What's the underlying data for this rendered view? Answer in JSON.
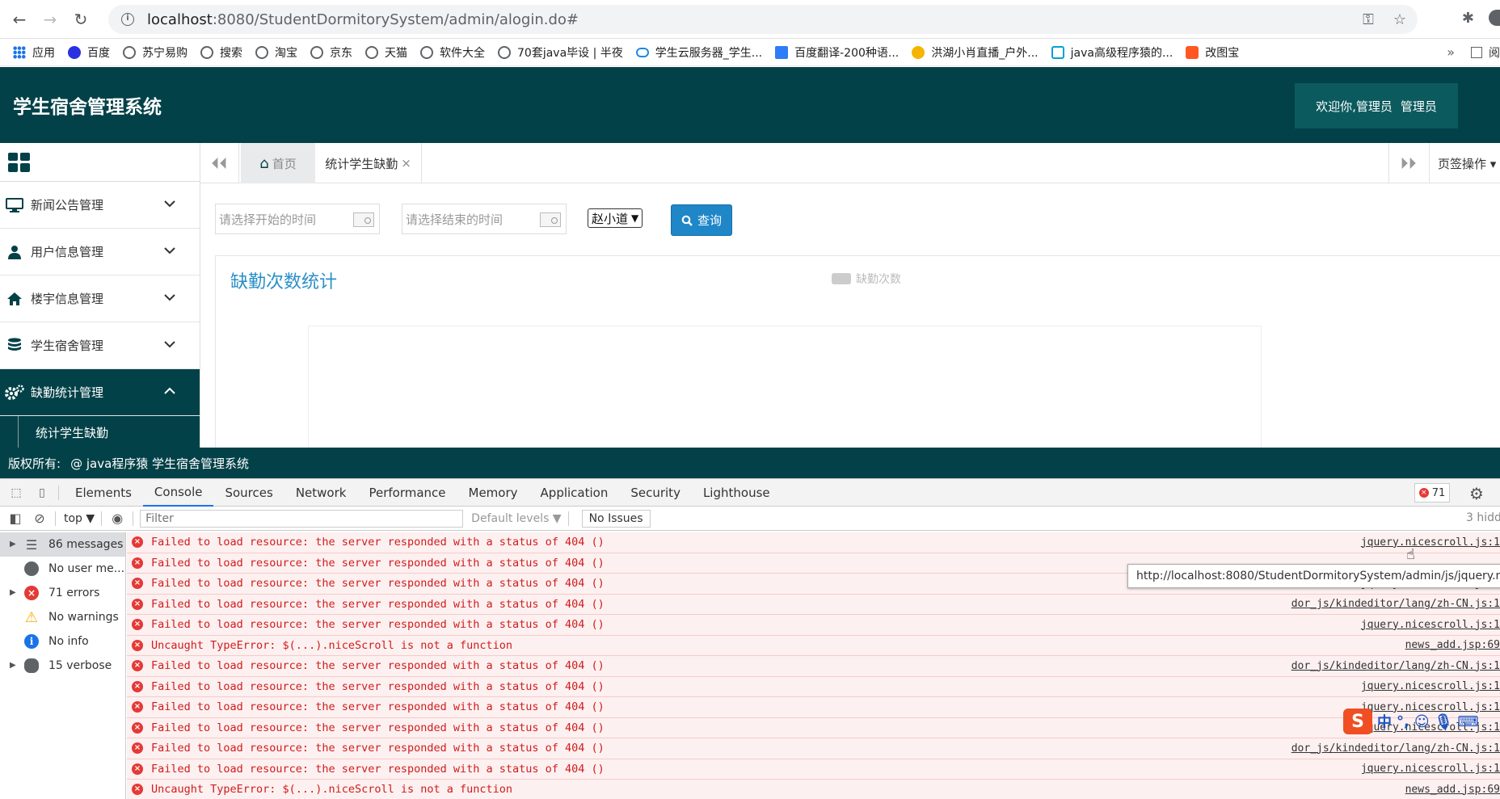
{
  "browser": {
    "url_host": "localhost",
    "url_rest": ":8080/StudentDormitorySystem/admin/alogin.do#",
    "bookmarks": [
      {
        "label": "应用",
        "icon": "apps-icon"
      },
      {
        "label": "百度",
        "icon": "baidu-icon"
      },
      {
        "label": "苏宁易购",
        "icon": "globe-icon"
      },
      {
        "label": "搜索",
        "icon": "globe-icon"
      },
      {
        "label": "淘宝",
        "icon": "globe-icon"
      },
      {
        "label": "京东",
        "icon": "globe-icon"
      },
      {
        "label": "天猫",
        "icon": "globe-icon"
      },
      {
        "label": "软件大全",
        "icon": "globe-icon"
      },
      {
        "label": "70套java毕设 | 半夜",
        "icon": "globe-icon"
      },
      {
        "label": "学生云服务器_学生...",
        "icon": "cloud-icon"
      },
      {
        "label": "百度翻译-200种语...",
        "icon": "fanyi-icon"
      },
      {
        "label": "洪湖小肖直播_户外...",
        "icon": "huya-icon"
      },
      {
        "label": "java高级程序猿的...",
        "icon": "bilibili-icon"
      },
      {
        "label": "改图宝",
        "icon": "gaitubao-icon"
      }
    ],
    "bookmarks_more": "»",
    "reading_list": "阅"
  },
  "app": {
    "title": "学生宿舍管理系统",
    "welcome": "欢迎你,管理员",
    "role": "管理员",
    "footer_label": "版权所有:",
    "footer_text": "@ java程序猿 学生宿舍管理系统"
  },
  "sidebar": {
    "items": [
      {
        "label": "新闻公告管理",
        "icon": "monitor-icon"
      },
      {
        "label": "用户信息管理",
        "icon": "user-icon"
      },
      {
        "label": "楼宇信息管理",
        "icon": "home-icon"
      },
      {
        "label": "学生宿舍管理",
        "icon": "database-icon"
      },
      {
        "label": "缺勤统计管理",
        "icon": "gears-icon"
      }
    ],
    "sub_items": [
      "统计学生缺勤"
    ]
  },
  "tabs": {
    "home": "首页",
    "current": "统计学生缺勤",
    "close": "×",
    "ops": "页签操作 ▾"
  },
  "filters": {
    "start_placeholder": "请选择开始的时间",
    "end_placeholder": "请选择结束的时间",
    "student_selected": "赵小道",
    "query_label": "查询"
  },
  "chart_data": {
    "type": "bar",
    "title": "缺勤次数统计",
    "legend": [
      "缺勤次数"
    ],
    "categories": [],
    "values": []
  },
  "devtools": {
    "tabs": [
      "Elements",
      "Console",
      "Sources",
      "Network",
      "Performance",
      "Memory",
      "Application",
      "Security",
      "Lighthouse"
    ],
    "active_tab": "Console",
    "error_count": "71",
    "context": "top ▼",
    "filter_placeholder": "Filter",
    "levels": "Default levels ▼",
    "no_issues": "No Issues",
    "hidden": "3 hidd",
    "side": [
      {
        "label": "86 messages",
        "expandable": true,
        "icon": "list"
      },
      {
        "label": "No user me...",
        "expandable": false,
        "icon": "user"
      },
      {
        "label": "71 errors",
        "expandable": true,
        "icon": "err"
      },
      {
        "label": "No warnings",
        "expandable": false,
        "icon": "warn"
      },
      {
        "label": "No info",
        "expandable": false,
        "icon": "info"
      },
      {
        "label": "15 verbose",
        "expandable": true,
        "icon": "bug"
      }
    ],
    "messages": [
      {
        "text": "Failed to load resource: the server responded with a status of 404 ()",
        "source": "jquery.nicescroll.js:1"
      },
      {
        "text": "Failed to load resource: the server responded with a status of 404 ()",
        "source": ""
      },
      {
        "text": "Failed to load resource: the server responded with a status of 404 ()",
        "source": "jquery.nicescroll.js:1"
      },
      {
        "text": "Failed to load resource: the server responded with a status of 404 ()",
        "source": "dor_js/kindeditor/lang/zh-CN.js:1"
      },
      {
        "text": "Failed to load resource: the server responded with a status of 404 ()",
        "source": "jquery.nicescroll.js:1"
      },
      {
        "text": "Uncaught TypeError: $(...).niceScroll is not a function",
        "source": "news_add.jsp:69"
      },
      {
        "text": "Failed to load resource: the server responded with a status of 404 ()",
        "source": "dor_js/kindeditor/lang/zh-CN.js:1"
      },
      {
        "text": "Failed to load resource: the server responded with a status of 404 ()",
        "source": "jquery.nicescroll.js:1"
      },
      {
        "text": "Failed to load resource: the server responded with a status of 404 ()",
        "source": "jquery.nicescroll.js:1"
      },
      {
        "text": "Failed to load resource: the server responded with a status of 404 ()",
        "source": "jquery.nicescroll.js:1"
      },
      {
        "text": "Failed to load resource: the server responded with a status of 404 ()",
        "source": "dor_js/kindeditor/lang/zh-CN.js:1"
      },
      {
        "text": "Failed to load resource: the server responded with a status of 404 ()",
        "source": "jquery.nicescroll.js:1"
      },
      {
        "text": "Uncaught TypeError: $(...).niceScroll is not a function",
        "source": "news_add.jsp:69"
      }
    ],
    "tooltip": "http://localhost:8080/StudentDormitorySystem/admin/js/jquery.nicescroll.js"
  },
  "ime": {
    "logo": "S",
    "mode": "中",
    "punct": "°,"
  }
}
